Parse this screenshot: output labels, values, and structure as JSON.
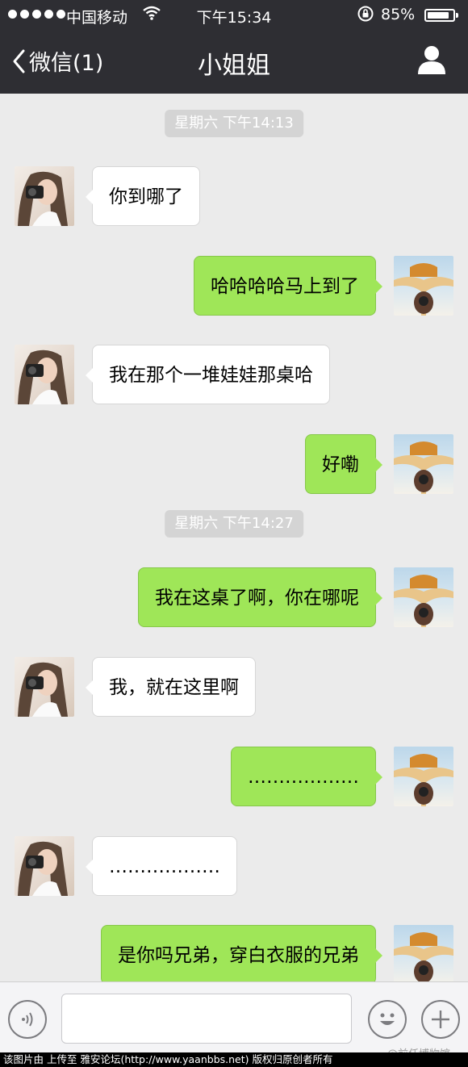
{
  "status_bar": {
    "carrier": "中国移动",
    "time": "下午15:34",
    "battery_text": "85%",
    "battery_level": 0.85
  },
  "nav": {
    "back_label": "微信(1)",
    "title": "小姐姐"
  },
  "timestamps": [
    "星期六 下午14:13",
    "星期六 下午14:27"
  ],
  "messages": [
    {
      "side": "left",
      "text": "你到哪了"
    },
    {
      "side": "right",
      "text": "哈哈哈哈马上到了"
    },
    {
      "side": "left",
      "text": "我在那个一堆娃娃那桌哈"
    },
    {
      "side": "right",
      "text": "好嘞"
    },
    {
      "side": "right",
      "text": "我在这桌了啊，你在哪呢"
    },
    {
      "side": "left",
      "text": "我，就在这里啊"
    },
    {
      "side": "right",
      "text": "………………"
    },
    {
      "side": "left",
      "text": "………………"
    },
    {
      "side": "right",
      "text": "是你吗兄弟，穿白衣服的兄弟"
    }
  ],
  "input_bar": {
    "watermark": "@前任博物馆"
  },
  "footer": {
    "text": "该图片由 上传至 雅安论坛(http://www.yaanbbs.net) 版权归原创者所有"
  },
  "colors": {
    "nav_bg": "#2e2e33",
    "chat_bg": "#ebebeb",
    "bubble_self": "#9fe658",
    "bubble_other": "#ffffff",
    "timestamp_bg": "#d4d4d4"
  },
  "icons": [
    "back-chevron-icon",
    "wifi-icon",
    "rotation-lock-icon",
    "battery-icon",
    "profile-icon",
    "voice-icon",
    "emoji-icon",
    "plus-icon"
  ]
}
